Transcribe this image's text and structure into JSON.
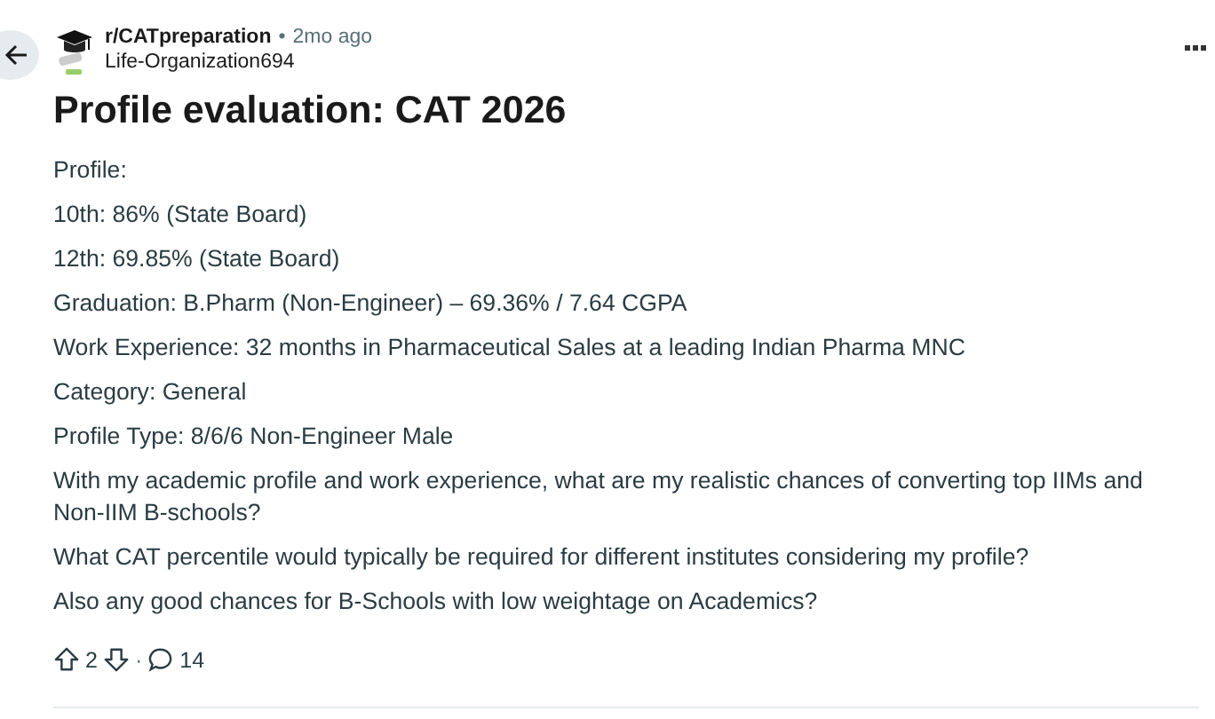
{
  "post": {
    "subreddit": "r/CATpreparation",
    "separator": "•",
    "time": "2mo ago",
    "author": "Life-Organization694",
    "title": "Profile evaluation: CAT 2026",
    "body": [
      "Profile:",
      "10th: 86% (State Board)",
      "12th: 69.85% (State Board)",
      "Graduation: B.Pharm (Non-Engineer) – 69.36% / 7.64 CGPA",
      "Work Experience: 32 months in Pharmaceutical Sales at a leading Indian Pharma MNC",
      "Category: General",
      "Profile Type: 8/6/6 Non-Engineer Male",
      "With my academic profile and work experience, what are my realistic chances of converting top IIMs and Non-IIM B-schools?",
      "What CAT percentile would typically be required for different institutes considering my profile?",
      "Also any good chances for B-Schools with low weightage on Academics?"
    ],
    "votes": "2",
    "actions_separator": "·",
    "comments": "14"
  }
}
